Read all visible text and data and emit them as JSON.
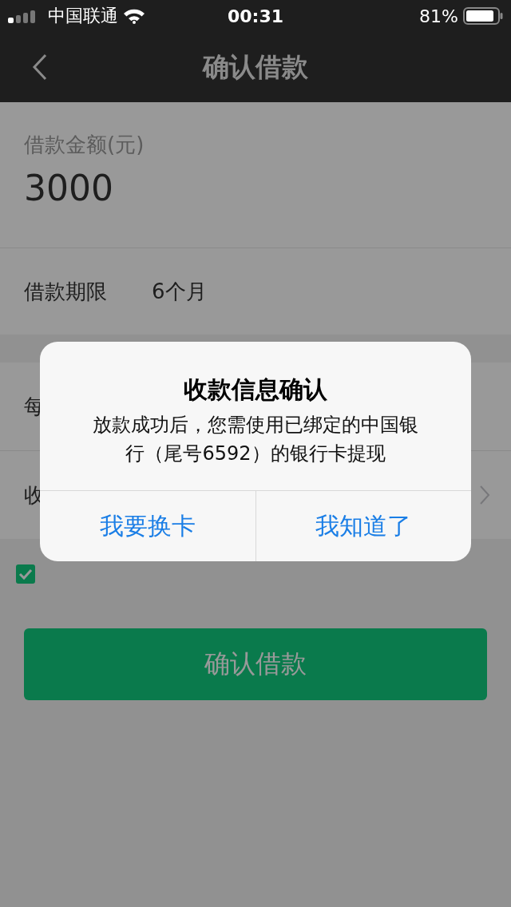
{
  "status_bar": {
    "carrier": "中国联通",
    "time": "00:31",
    "battery": "81%"
  },
  "nav": {
    "title": "确认借款"
  },
  "amount": {
    "label": "借款金额(元)",
    "value": "3000"
  },
  "term": {
    "label": "借款期限",
    "value": "6个月"
  },
  "rows": [
    {
      "label": "每",
      "chevron": false
    },
    {
      "label": "收",
      "chevron": true
    }
  ],
  "agreement": {
    "checked": true
  },
  "submit_button": "确认借款",
  "dialog": {
    "title": "收款信息确认",
    "message": "放款成功后，您需使用已绑定的中国银行（尾号6592）的银行卡提现",
    "buttons": [
      "我要换卡",
      "我知道了"
    ]
  }
}
